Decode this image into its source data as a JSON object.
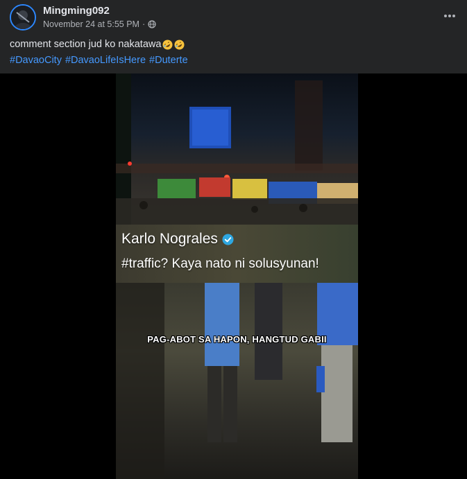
{
  "post": {
    "author": "Mingming092",
    "timestamp": "November 24 at 5:55 PM",
    "separator": "·",
    "privacy_icon": "globe-icon",
    "more_icon": "more-horizontal-icon",
    "caption": "comment section jud ko nakatawa",
    "caption_emojis": [
      "rolling-on-floor-laughing-emoji",
      "rolling-on-floor-laughing-emoji"
    ],
    "hashtags": [
      "#DavaoCity",
      "#DavaoLifeIsHere",
      "#Duterte"
    ]
  },
  "video": {
    "creator_name": "Karlo Nograles",
    "verified_icon": "verified-badge-icon",
    "quote": "#traffic? Kaya nato ni solusyunan!",
    "subtitle": "PAG-ABOT SA HAPON, HANGTUD GABII"
  },
  "colors": {
    "background": "#242526",
    "text_primary": "#e4e6eb",
    "text_secondary": "#b0b3b8",
    "hashtag": "#4599ff",
    "verified": "#2ea7e0",
    "avatar_ring": "#2d88ff"
  }
}
